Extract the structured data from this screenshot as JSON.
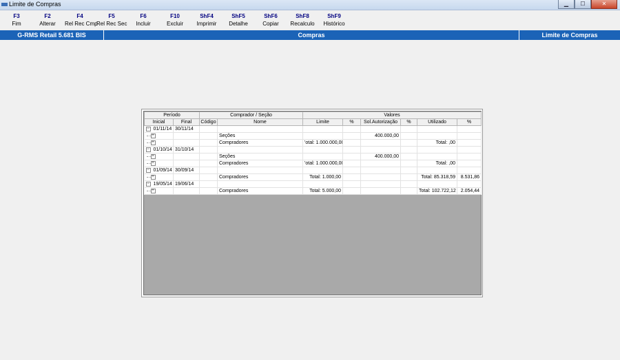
{
  "window": {
    "title": "Limite de Compras"
  },
  "window_buttons": {
    "minimize": "▁",
    "maximize": "☐",
    "close": "✕"
  },
  "toolbar": [
    {
      "key": "F3",
      "label": "Fim"
    },
    {
      "key": "F2",
      "label": "Alterar"
    },
    {
      "key": "F4",
      "label": "Rel Rec Cmp"
    },
    {
      "key": "F5",
      "label": "Rel Rec Sec"
    },
    {
      "key": "F6",
      "label": "Incluir"
    },
    {
      "key": "F10",
      "label": "Excluir"
    },
    {
      "key": "ShF4",
      "label": "Imprimir"
    },
    {
      "key": "ShF5",
      "label": "Detalhe"
    },
    {
      "key": "ShF6",
      "label": "Copiar"
    },
    {
      "key": "ShF8",
      "label": "Recalculo"
    },
    {
      "key": "ShF9",
      "label": "Histórico"
    }
  ],
  "strip": {
    "app": "G-RMS Retail 5.681 BIS",
    "module": "Compras",
    "screen": "Limite de Compras"
  },
  "grid": {
    "group_headers": [
      "Período",
      "Comprador / Seção",
      "Valores"
    ],
    "columns": [
      "Inicial",
      "Final",
      "Código",
      "Nome",
      "Limite",
      "%",
      "Sol.Autorização",
      "%",
      "Utilizado",
      "%"
    ],
    "rows": [
      {
        "type": "period",
        "toggle": "−",
        "inicial": "01/11/14",
        "final": "30/11/14"
      },
      {
        "type": "child",
        "toggle": "+",
        "nome": "Seções",
        "limite": "",
        "sol": "400.000,00",
        "utilizado": "",
        "pct": ""
      },
      {
        "type": "child",
        "toggle": "+",
        "nome": "Compradores",
        "limite": "'otal: 1.000.000,00",
        "sol": "",
        "utilizado": "Total: ,00",
        "pct": ""
      },
      {
        "type": "period",
        "toggle": "−",
        "inicial": "01/10/14",
        "final": "31/10/14"
      },
      {
        "type": "child",
        "toggle": "+",
        "nome": "Seções",
        "limite": "",
        "sol": "400.000,00",
        "utilizado": "",
        "pct": ""
      },
      {
        "type": "child",
        "toggle": "+",
        "nome": "Compradores",
        "limite": "'otal: 1.000.000,00",
        "sol": "",
        "utilizado": "Total: ,00",
        "pct": ""
      },
      {
        "type": "period",
        "toggle": "−",
        "inicial": "01/09/14",
        "final": "30/09/14"
      },
      {
        "type": "child",
        "toggle": "+",
        "nome": "Compradores",
        "limite": "Total: 1.000,00",
        "sol": "",
        "utilizado": "Total: 85.318,59",
        "pct": "8.531,86"
      },
      {
        "type": "period",
        "toggle": "−",
        "inicial": "19/05/14",
        "final": "19/06/14"
      },
      {
        "type": "child",
        "toggle": "+",
        "nome": "Compradores",
        "limite": "Total: 5.000,00",
        "sol": "",
        "utilizado": "Total: 102.722,12",
        "pct": "2.054,44"
      }
    ]
  }
}
